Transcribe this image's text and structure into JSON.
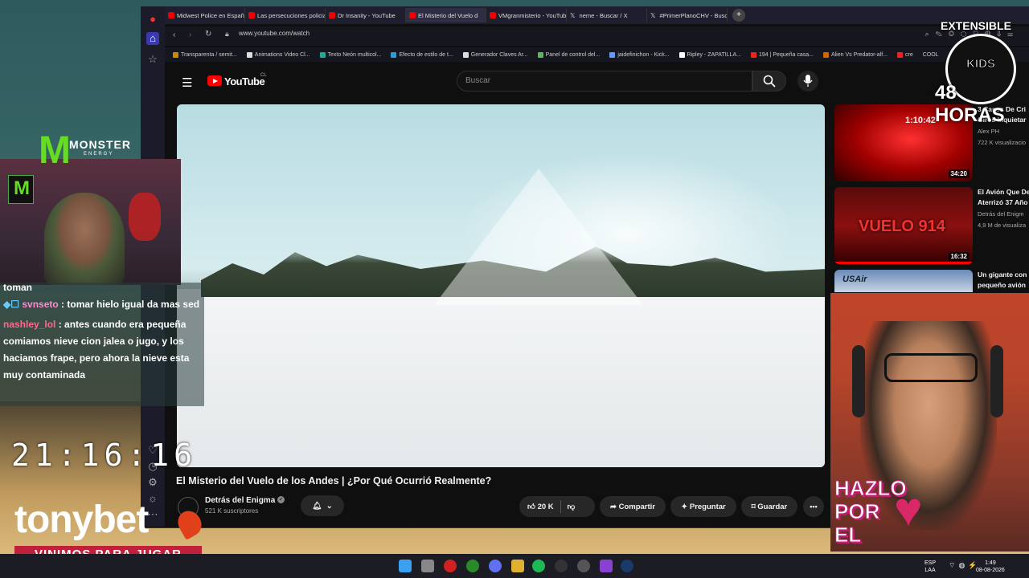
{
  "browser": {
    "tabs": [
      {
        "label": "Midwest Police en Españo",
        "icon": "youtube-icon"
      },
      {
        "label": "Las persecuciones policial",
        "icon": "youtube-icon"
      },
      {
        "label": "Dr Insanity - YouTube",
        "icon": "youtube-icon"
      },
      {
        "label": "El Misterio del Vuelo d",
        "icon": "youtube-icon",
        "active": true
      },
      {
        "label": "VMgranmisterio - YouTub",
        "icon": "youtube-icon"
      },
      {
        "label": "neme - Buscar / X",
        "icon": "x-icon"
      },
      {
        "label": "#PrimerPlanoCHV - Busca",
        "icon": "x-icon"
      }
    ],
    "new_tab": "+",
    "url": "www.youtube.com/watch",
    "bookmarks": [
      "Transparenta / semit...",
      "Animations Video Cl...",
      "Texto Neón multicol...",
      "Efecto de estilo de t...",
      "Generador Claves Ar...",
      "Panel de control del...",
      "jaidefinichon - Kick...",
      "Ripley - ZAPATILLA...",
      "194 | Pequeña casa...",
      "Alien Vs Predator-alf...",
      "cre",
      "COOL"
    ]
  },
  "youtube": {
    "logo": "YouTube",
    "country": "CL",
    "search_placeholder": "Buscar",
    "video": {
      "title": "El Misterio del Vuelo de los Andes | ¿Por Qué Ocurrió Realmente?",
      "channel": "Detrás del Enigma",
      "subscribers": "521 K suscriptores",
      "likes": "20 K",
      "share": "Compartir",
      "ask": "Preguntar",
      "save": "Guardar",
      "more": "•••"
    },
    "related": [
      {
        "title": "3 Casos De Cri\nGiros Inquietar",
        "channel": "Alex PH",
        "views": "722 K visualizacio",
        "duration": "34:20",
        "thumb_text": "1:10:42"
      },
      {
        "title": "El Avión Que De\nAterrizó 37 Año",
        "channel": "Detrás del Enigm",
        "views": "4,9 M de visualiza",
        "duration": "16:32",
        "thumb_text": "VUELO 914"
      },
      {
        "title": "Un gigante con\npequeño avión",
        "channel": "",
        "views": "",
        "duration": "",
        "thumb_text": "USAir"
      }
    ]
  },
  "stream": {
    "chat": [
      {
        "user": "",
        "message": "toman"
      },
      {
        "user": "svnseto",
        "message": "tomar hielo igual da mas sed"
      },
      {
        "user": "nashley_lol",
        "message": "antes cuando era pequeña comiamos nieve cion jalea o jugo, y los haciamos frape, pero ahora la nieve esta muy contaminada"
      }
    ],
    "clock": "21:16:16",
    "sponsor": "MONSTER",
    "sponsor_sub": "ENERGY",
    "brand": "tonybet",
    "tagline": "VINIMOS PARA JUGAR",
    "badge_top": "EXTENSIBLE",
    "badge_kids": "KIDS",
    "badge_bottom": "48 HORAS",
    "hazlo": [
      "HAZLO",
      "POR",
      "EL"
    ]
  },
  "taskbar": {
    "lang": "ESP",
    "lang_sub": "LAA",
    "time": "1:49",
    "date": "08-08-2026"
  },
  "colors": {
    "youtube_red": "#ff0000",
    "dark": "#0f0f0f",
    "pill": "#272727",
    "tagline": "#c0203a"
  }
}
